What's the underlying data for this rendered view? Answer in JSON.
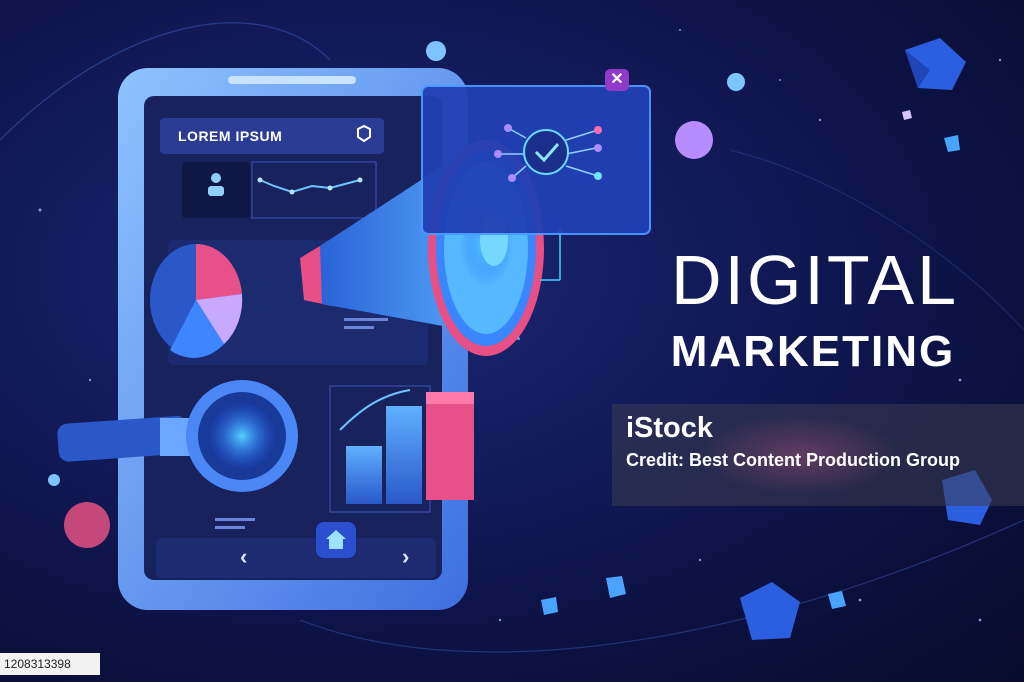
{
  "title": {
    "line1": "DIGITAL",
    "line2": "MARKETING"
  },
  "phone": {
    "header": "LOREM IPSUM",
    "nav_prev": "‹",
    "nav_next": "›"
  },
  "watermark": {
    "logo": "iStock",
    "credit": "Credit: Best Content Production Group"
  },
  "image_id": "1208313398",
  "popup_close": "✕",
  "icons": [
    "settings-hexagon-icon",
    "user-icon",
    "home-icon",
    "checkmark-icon",
    "close-icon",
    "megaphone-icon",
    "magnifier-icon",
    "pie-chart-icon",
    "bar-chart-icon"
  ],
  "colors": {
    "background": "#131b5c",
    "phone_frame": "#4f8ff0",
    "screen": "#18235d",
    "megaphone_rim": "#e84f85",
    "accent_purple": "#8f3ac9",
    "text": "#ffffff"
  }
}
